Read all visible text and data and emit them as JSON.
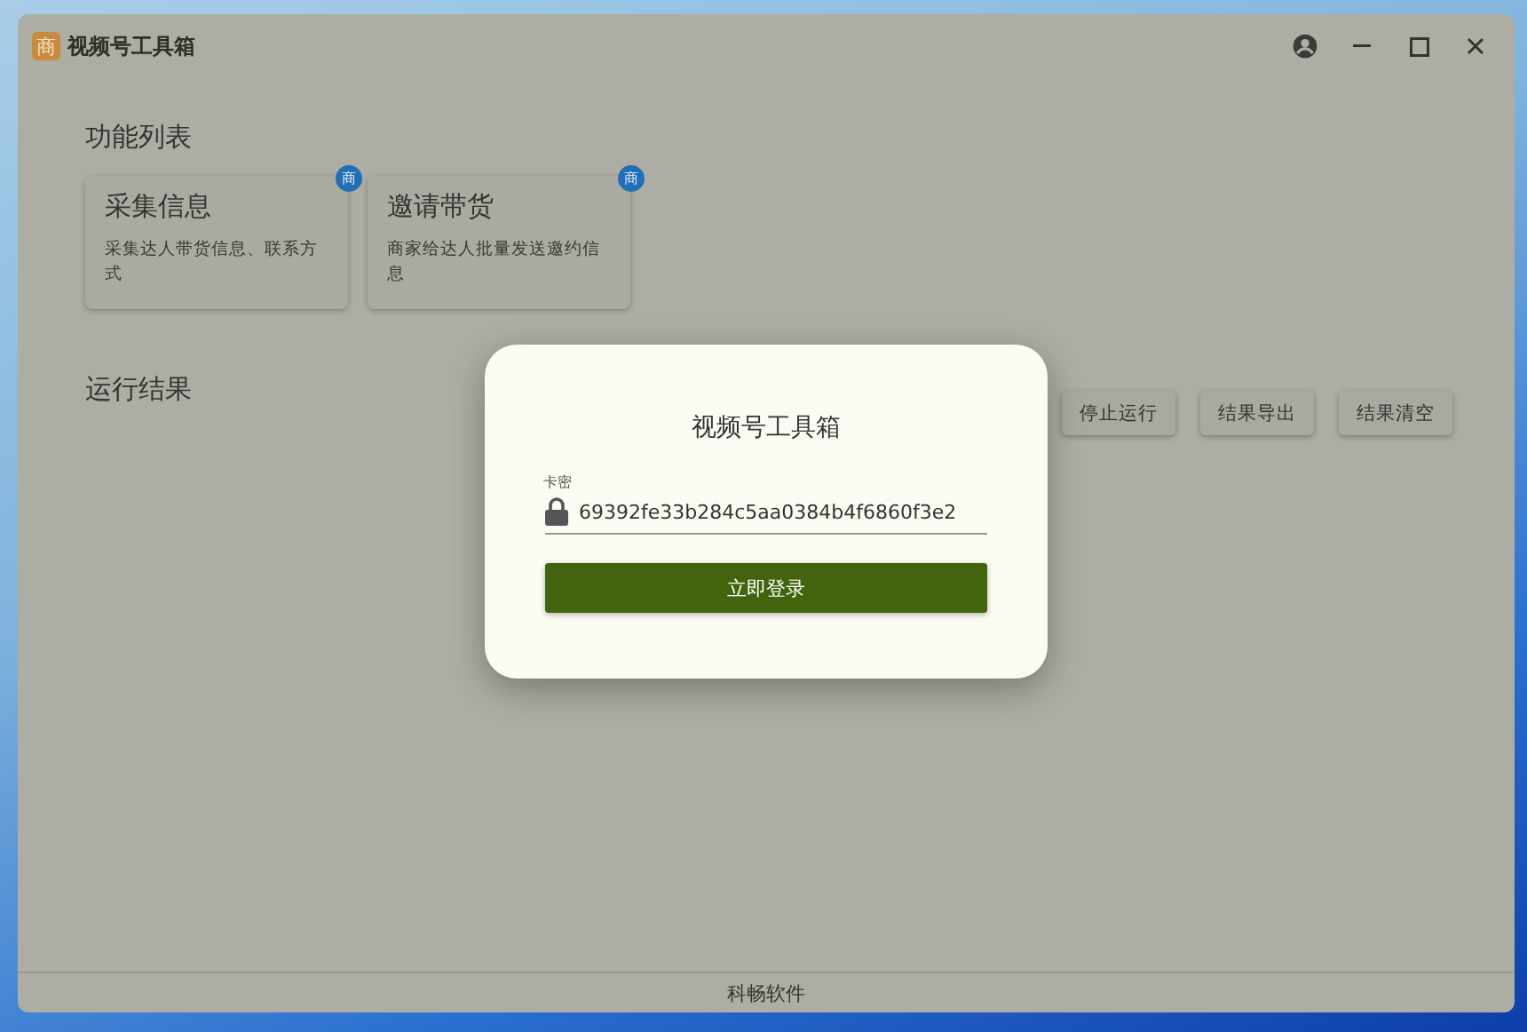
{
  "window": {
    "title": "视频号工具箱",
    "logo_glyph": "商"
  },
  "features": {
    "title": "功能列表",
    "items": [
      {
        "title": "采集信息",
        "description": "采集达人带货信息、联系方式",
        "badge": "商"
      },
      {
        "title": "邀请带货",
        "description": "商家给达人批量发送邀约信息",
        "badge": "商"
      }
    ]
  },
  "results": {
    "title": "运行结果",
    "buttons": [
      "停止运行",
      "结果导出",
      "结果清空"
    ]
  },
  "footer": "科畅软件",
  "login_dialog": {
    "title": "视频号工具箱",
    "field": {
      "label": "卡密",
      "value": "69392fe33b284c5aa0384b4f6860f3e2"
    },
    "submit": "立即登录"
  }
}
